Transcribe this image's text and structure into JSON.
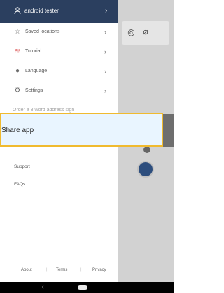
{
  "drawer": {
    "header": {
      "user_name": "android tester",
      "background": "#2b3f5f"
    },
    "items": [
      {
        "label": "Saved locations",
        "icon": "star-outline-icon"
      },
      {
        "label": "Tutorial",
        "icon": "tutorial-icon"
      },
      {
        "label": "Language",
        "icon": "language-icon"
      },
      {
        "label": "Settings",
        "icon": "gear-icon"
      }
    ],
    "partial_item_label": "Order a 3 word address sign",
    "share_label": "Share app",
    "support_label": "Support",
    "faqs_label": "FAQs",
    "footer": {
      "about": "About",
      "terms": "Terms",
      "privacy": "Privacy"
    }
  },
  "highlight": {
    "border_color": "#f0ba2f",
    "background": "#e9f5ff"
  },
  "system": {
    "nav_back_icon": "back-icon",
    "nav_home_icon": "home-pill-icon"
  }
}
